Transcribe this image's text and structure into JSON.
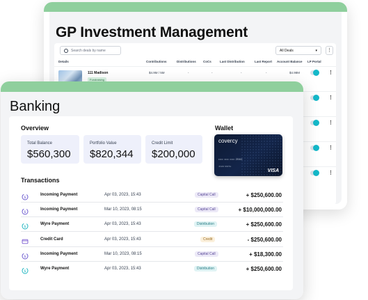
{
  "gp": {
    "title": "GP Investment Management",
    "search_placeholder": "Search deals by name",
    "deals_filter": "All Deals",
    "columns": [
      "Details",
      "Contributions",
      "Distributions",
      "CoCs",
      "Last Distribution",
      "Last Report",
      "Account Balance",
      "LP Portal"
    ],
    "deal": {
      "name": "111 Madison",
      "tag": "Fundraising",
      "contributions": "$4.9M / 5M",
      "distributions": "-",
      "cocs": "-",
      "last_distribution": "-",
      "last_report": "-",
      "account_balance": "$4.98M"
    }
  },
  "banking": {
    "title": "Banking",
    "overview_title": "Overview",
    "wallet_title": "Wallet",
    "stats": [
      {
        "label": "Total Balance",
        "value": "$560,300"
      },
      {
        "label": "Portfolio Value",
        "value": "$820,344"
      },
      {
        "label": "Credit Limit",
        "value": "$200,000"
      }
    ],
    "card": {
      "brand": "covercy",
      "number": "•••• •••• •••• 2561",
      "holder": "JOHN SMITH",
      "network": "VISA"
    },
    "transactions_title": "Transactions",
    "transactions": [
      {
        "name": "Incoming Payment",
        "date": "Apr 03, 2023, 15:43",
        "badge": "Capital Call",
        "amount": "+ $250,600.00",
        "icon": "incoming-payment-icon"
      },
      {
        "name": "Incoming Payment",
        "date": "Mar 10, 2023, 08:15",
        "badge": "Capital Call",
        "amount": "+ $10,000,000.00",
        "icon": "incoming-payment-icon"
      },
      {
        "name": "Wyre Payment",
        "date": "Apr 03, 2023, 15:43",
        "badge": "Distribution",
        "amount": "+ $250,600.00",
        "icon": "wire-payment-icon"
      },
      {
        "name": "Credit Card",
        "date": "Apr 03, 2023, 15:43",
        "badge": "Credit",
        "amount": "- $250,600.00",
        "icon": "credit-card-icon"
      },
      {
        "name": "Incoming Payment",
        "date": "Mar 10, 2023, 08:15",
        "badge": "Capital Call",
        "amount": "+ $18,300.00",
        "icon": "incoming-payment-icon"
      },
      {
        "name": "Wyre Payment",
        "date": "Apr 03, 2023, 15:43",
        "badge": "Distribution",
        "amount": "+ $250,600.00",
        "icon": "wire-payment-icon"
      }
    ]
  },
  "colors": {
    "accent_green": "#8fcf9d",
    "capital_call_bg": "#ece9f7",
    "distribution_bg": "#dff3f4",
    "credit_bg": "#fbf0dc",
    "toggle_on": "#14b8c9"
  }
}
